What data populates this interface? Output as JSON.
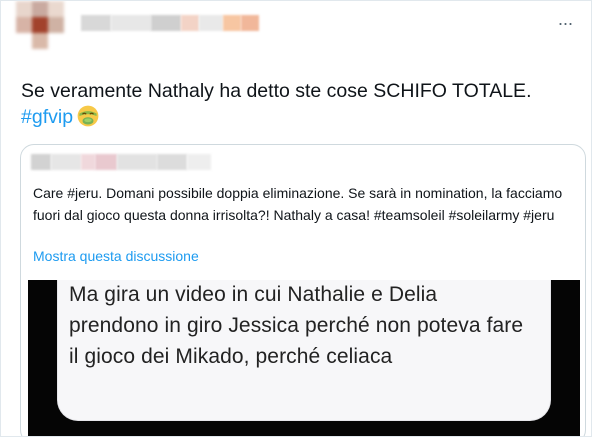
{
  "tweet": {
    "more_label": "···",
    "text_main": "Se veramente Nathaly ha detto ste cose SCHIFO TOTALE. ",
    "hashtag": "#gfvip",
    "emoji": "nauseated-face-icon"
  },
  "quoted": {
    "text": "Care #jeru. Domani possibile doppia eliminazione. Se sarà in nomination, la facciamo fuori dal gioco questa donna irrisolta?! Nathaly a casa! #teamsoleil #soleilarmy #jeru",
    "show_thread_label": "Mostra questa discussione",
    "media_text": "Ma gira un video in cui Nathalie e Delia prendono in giro Jessica perché non poteva fare il gioco dei Mikado, perché celiaca"
  },
  "colors": {
    "link": "#1d9bf0",
    "text": "#0f1419",
    "border": "#cfd9de"
  }
}
